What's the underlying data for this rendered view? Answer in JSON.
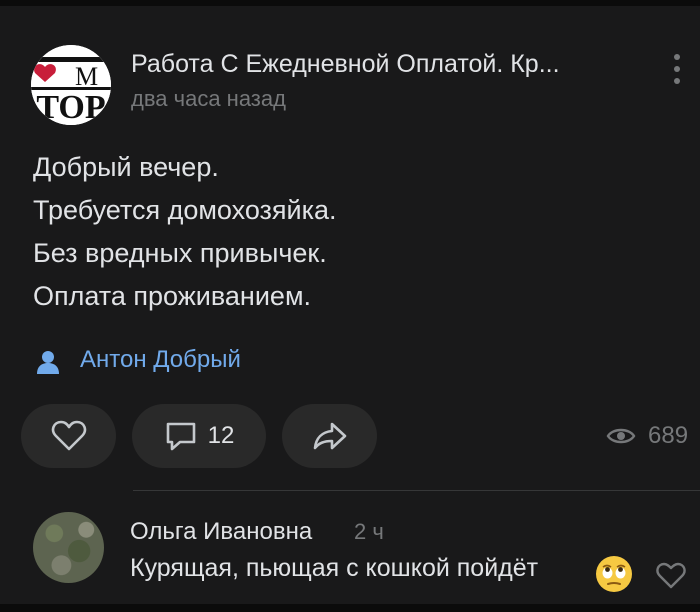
{
  "post": {
    "group_name": "Работа С Ежедневной Оплатой. Кр...",
    "time": "два часа назад",
    "logo_text": "TOP",
    "lines": [
      "Добрый вечер.",
      "Требуется домохозяйка.",
      "Без вредных привычек.",
      "Оплата проживанием."
    ],
    "author": "Антон Добрый",
    "comments_count": "12",
    "views_count": "689",
    "icons": {
      "more": "more-vertical-icon",
      "author": "person-icon",
      "like": "heart-icon",
      "comment": "comment-icon",
      "share": "share-icon",
      "views": "eye-icon"
    }
  },
  "comment": {
    "author": "Ольга Ивановна",
    "time": "2 ч",
    "text": "Курящая, пьющая с кошкой пойдёт",
    "emoji": "eye-roll-emoji",
    "like_icon": "heart-icon"
  },
  "colors": {
    "background": "#19191a",
    "accent": "#71aaeb",
    "secondary_text": "#76787a",
    "pill": "#292929"
  }
}
